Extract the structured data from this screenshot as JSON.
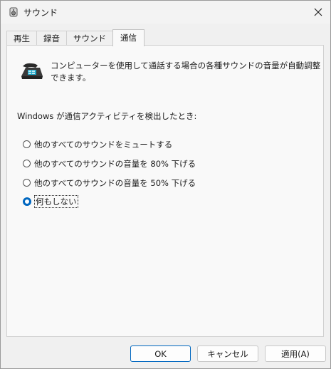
{
  "window": {
    "title": "サウンド",
    "close_label": "✕"
  },
  "tabs": [
    {
      "label": "再生",
      "active": false
    },
    {
      "label": "録音",
      "active": false
    },
    {
      "label": "サウンド",
      "active": false
    },
    {
      "label": "通信",
      "active": true
    }
  ],
  "panel": {
    "description": "コンピューターを使用して通話する場合の各種サウンドの音量が自動調整できます。",
    "detect_label": "Windows が通信アクティビティを検出したとき:",
    "options": [
      {
        "label": "他のすべてのサウンドをミュートする",
        "checked": false
      },
      {
        "label": "他のすべてのサウンドの音量を 80% 下げる",
        "checked": false
      },
      {
        "label": "他のすべてのサウンドの音量を 50% 下げる",
        "checked": false
      },
      {
        "label": "何もしない",
        "checked": true
      }
    ]
  },
  "buttons": {
    "ok": "OK",
    "cancel": "キャンセル",
    "apply": "適用(A)"
  },
  "colors": {
    "accent": "#0067c0"
  }
}
